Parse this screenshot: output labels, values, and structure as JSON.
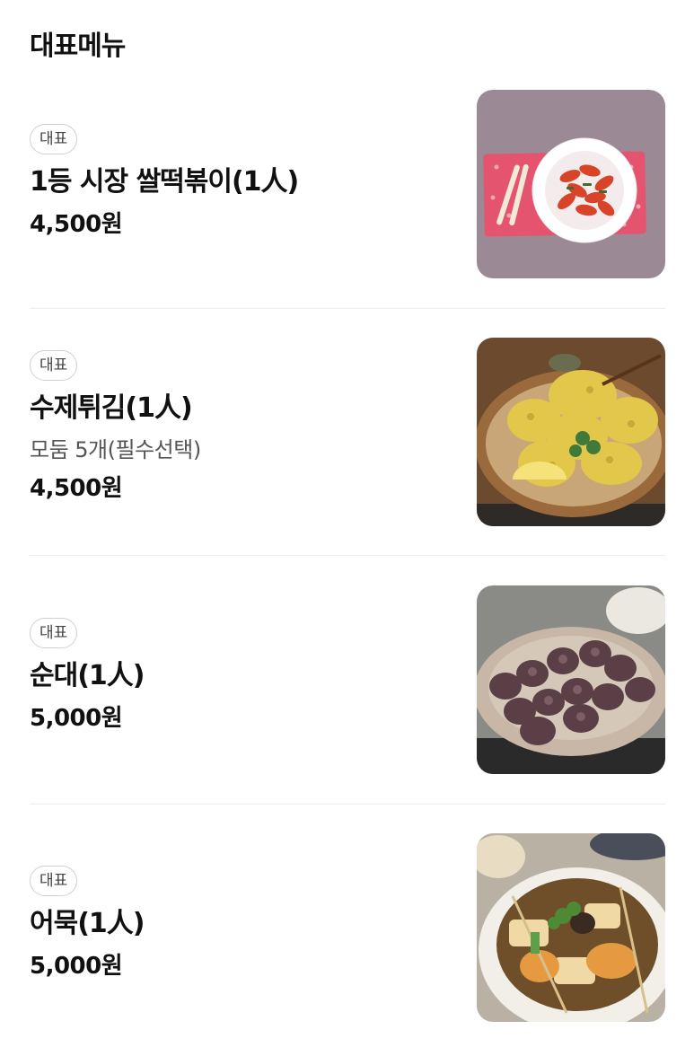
{
  "section": {
    "title": "대표메뉴"
  },
  "items": [
    {
      "badge": "대표",
      "name": "1등 시장 쌀떡볶이(1人)",
      "price": "4,500원",
      "image": "tteokbokki-photo"
    },
    {
      "badge": "대표",
      "name": "수제튀김(1人)",
      "description": "모둠 5개(필수선택)",
      "price": "4,500원",
      "image": "twigim-photo"
    },
    {
      "badge": "대표",
      "name": "순대(1人)",
      "price": "5,000원",
      "image": "sundae-photo"
    },
    {
      "badge": "대표",
      "name": "어묵(1人)",
      "price": "5,000원",
      "image": "eomuk-photo"
    }
  ]
}
